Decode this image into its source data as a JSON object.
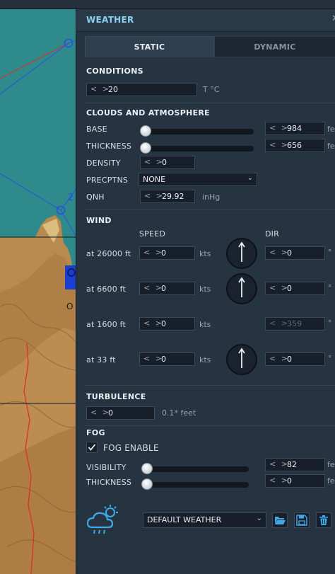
{
  "panel": {
    "title": "WEATHER",
    "tabs": [
      {
        "label": "STATIC",
        "active": true
      },
      {
        "label": "DYNAMIC",
        "active": false
      }
    ]
  },
  "conditions": {
    "title": "CONDITIONS",
    "temperature": {
      "value": "20",
      "unit": "T °C"
    }
  },
  "clouds": {
    "title": "CLOUDS AND ATMOSPHERE",
    "base": {
      "label": "BASE",
      "value": "984",
      "unit": "fe",
      "slider_fraction": 0.0
    },
    "thickness": {
      "label": "THICKNESS",
      "value": "656",
      "unit": "fe",
      "slider_fraction": 0.0
    },
    "density": {
      "label": "DENSITY",
      "value": "0"
    },
    "precptns": {
      "label": "PRECPTNS",
      "value": "NONE"
    },
    "qnh": {
      "label": "QNH",
      "value": "29.92",
      "unit": "inHg"
    }
  },
  "wind": {
    "title": "WIND",
    "speed_header": "SPEED",
    "dir_header": "DIR",
    "speed_unit": "kts",
    "dir_unit": "°",
    "rows": [
      {
        "label": "at 26000 ft",
        "speed": "0",
        "dir": "0",
        "dir_disabled": false,
        "show_compass": true
      },
      {
        "label": "at 6600 ft",
        "speed": "0",
        "dir": "0",
        "dir_disabled": false,
        "show_compass": true
      },
      {
        "label": "at 1600 ft",
        "speed": "0",
        "dir": "359",
        "dir_disabled": true,
        "show_compass": false
      },
      {
        "label": "at 33 ft",
        "speed": "0",
        "dir": "0",
        "dir_disabled": false,
        "show_compass": true
      }
    ]
  },
  "turbulence": {
    "title": "TURBULENCE",
    "value": "0",
    "unit": "0.1* feet"
  },
  "fog": {
    "title": "FOG",
    "enable_label": "FOG ENABLE",
    "enabled": true,
    "visibility": {
      "label": "VISIBILITY",
      "value": "82",
      "unit": "fe",
      "slider_fraction": 0.0
    },
    "thickness": {
      "label": "THICKNESS",
      "value": "0",
      "unit": "fe",
      "slider_fraction": 0.0
    }
  },
  "preset": {
    "icon": "weather-cloud-sun-rain-icon",
    "selected": "DEFAULT WEATHER",
    "buttons": [
      "open-folder-icon",
      "save-icon",
      "trash-icon"
    ]
  },
  "map": {
    "marker_label": "2",
    "town_label": "O"
  },
  "colors": {
    "accent": "#8ad0ee",
    "panel_bg": "#263442",
    "input_bg": "#17202a",
    "icon_blue": "#3fa9e8"
  }
}
